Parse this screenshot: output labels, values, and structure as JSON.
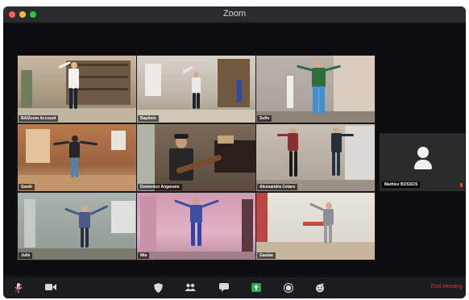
{
  "window": {
    "title": "Zoom"
  },
  "participants": [
    {
      "name": "BAIZoom Account"
    },
    {
      "name": "Baptiste"
    },
    {
      "name": "Sofie"
    },
    {
      "name": "Sarah"
    },
    {
      "name": "Domenico Angarano"
    },
    {
      "name": "Alessandra   Cetaro"
    },
    {
      "name": "Julie"
    },
    {
      "name": "Mia"
    },
    {
      "name": "Gaetan"
    },
    {
      "name": "Mathiee BOSSOS"
    }
  ],
  "toolbar": {
    "icons": [
      "microphone-muted-icon",
      "video-icon",
      "security-icon",
      "participants-icon",
      "chat-icon",
      "share-screen-icon",
      "record-icon",
      "reactions-icon"
    ],
    "end_meeting_label": "End Meeting"
  },
  "colors": {
    "end_meeting": "#e0312a",
    "share_screen": "#22b14c",
    "background": "#111214"
  }
}
